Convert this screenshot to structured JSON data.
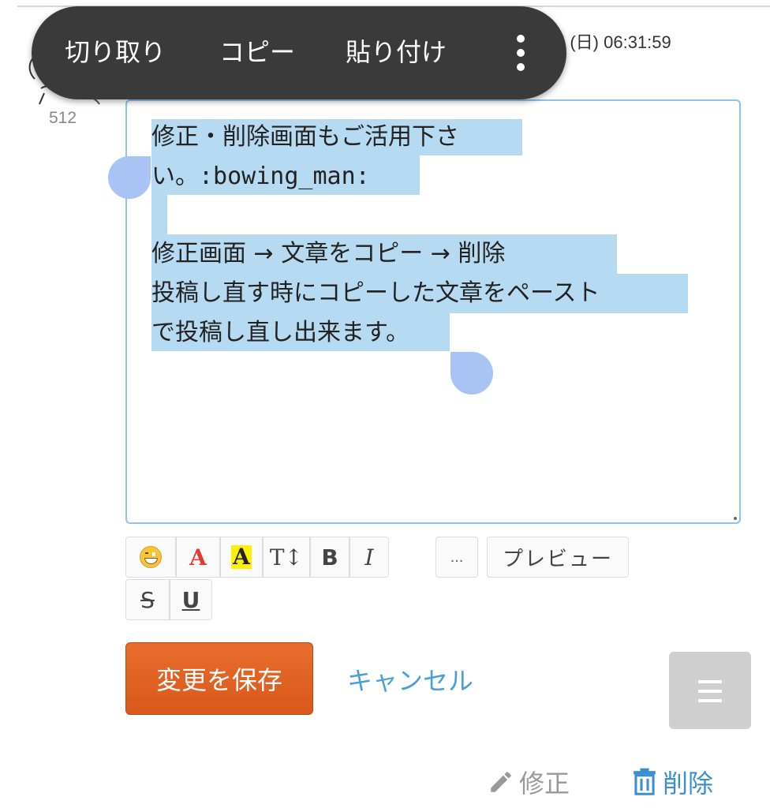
{
  "context_menu": {
    "cut": "切り取り",
    "copy": "コピー",
    "paste": "貼り付け"
  },
  "post": {
    "date_fragment": "5 (日) 06:31:59",
    "count": "512"
  },
  "editor": {
    "lines": [
      "修正・削除画面もご活用下さ",
      "い。:bowing_man:",
      "",
      "修正画面 → 文章をコピー → 削除",
      "投稿し直す時にコピーした文章をペースト",
      "で投稿し直し出来ます。"
    ]
  },
  "toolbar": {
    "color_glyph": "A",
    "bg_glyph": "A",
    "size_glyph": "T↕",
    "bold_glyph": "B",
    "italic_glyph": "I",
    "more_glyph": "...",
    "preview_label": "プレビュー",
    "strike_glyph": "S",
    "underline_glyph": "U"
  },
  "actions": {
    "save_label": "変更を保存",
    "cancel_label": "キャンセル",
    "edit_label": "修正",
    "delete_label": "削除"
  },
  "colors": {
    "selection": "#b7daf3",
    "save_button": "#e0611f",
    "link": "#4a9fd8",
    "menu_bg": "#3a3a3a"
  },
  "icons": {
    "more": "more-vert-icon",
    "emoji": "emoji-icon",
    "menu": "hamburger-menu-icon",
    "edit": "pencil-icon",
    "delete": "trash-icon"
  }
}
